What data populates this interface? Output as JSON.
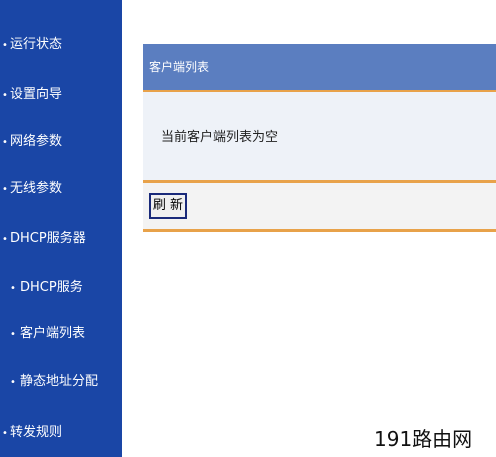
{
  "sidebar": {
    "items": [
      {
        "label": "运行状态"
      },
      {
        "label": "设置向导"
      },
      {
        "label": "网络参数"
      },
      {
        "label": "无线参数"
      },
      {
        "label": "DHCP服务器"
      },
      {
        "label": "DHCP服务"
      },
      {
        "label": "客户端列表"
      },
      {
        "label": "静态地址分配"
      },
      {
        "label": "转发规则"
      }
    ]
  },
  "panel": {
    "title": "客户端列表",
    "message": "当前客户端列表为空",
    "refresh_label": "刷 新"
  },
  "watermark": "191路由网",
  "colors": {
    "sidebar": "#1a46a6",
    "header": "#5b7ec0",
    "accent": "#e8a24a"
  }
}
